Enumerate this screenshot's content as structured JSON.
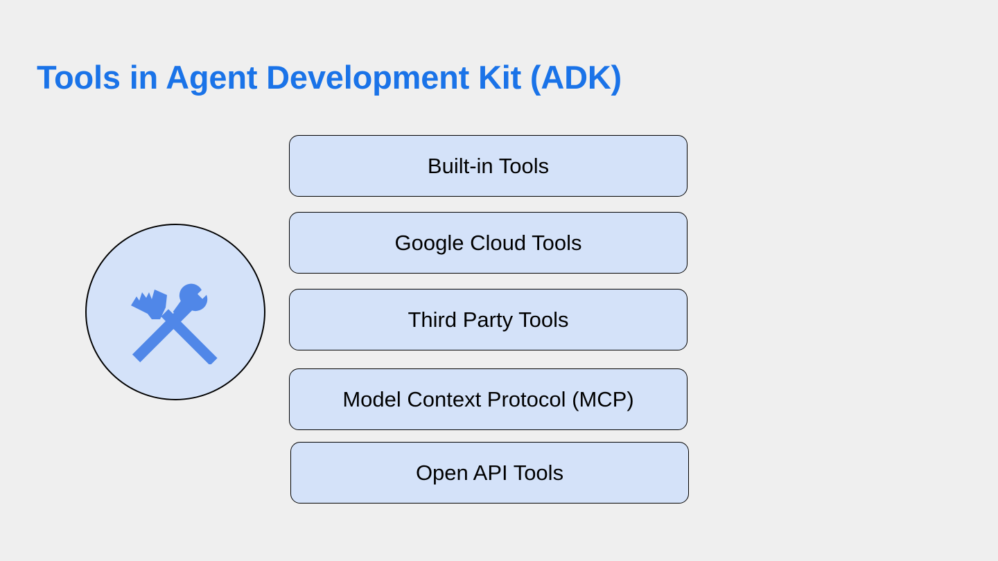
{
  "slide": {
    "title": "Tools in Agent Development Kit (ADK)"
  },
  "icon": {
    "name": "hammer-wrench-icon",
    "color": "#5087e8"
  },
  "tool_categories": [
    {
      "label": "Built-in Tools"
    },
    {
      "label": "Google Cloud Tools"
    },
    {
      "label": "Third Party Tools"
    },
    {
      "label": "Model Context Protocol (MCP)"
    },
    {
      "label": "Open API Tools"
    }
  ],
  "colors": {
    "title": "#1a73e8",
    "box_fill": "#d4e2f9",
    "background": "#efefef"
  }
}
